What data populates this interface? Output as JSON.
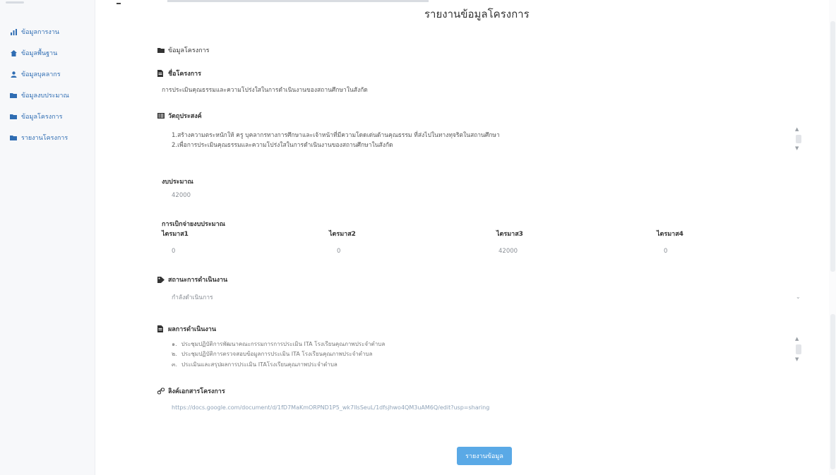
{
  "sidebar": {
    "items": [
      {
        "label": "ข้อมูลการงาน",
        "icon": "chart-icon"
      },
      {
        "label": "ข้อมูลพื้นฐาน",
        "icon": "home-icon"
      },
      {
        "label": "ข้อมูลบุคลากร",
        "icon": "user-icon"
      },
      {
        "label": "ข้อมูลงบประมาณ",
        "icon": "folder-icon"
      },
      {
        "label": "ข้อมูลโครงการ",
        "icon": "folder-icon"
      },
      {
        "label": "รายงานโครงการ",
        "icon": "folder-icon"
      }
    ]
  },
  "page": {
    "title": "รายงานข้อมูลโครงการ"
  },
  "section": {
    "header": "ข้อมูลโครงการ"
  },
  "project": {
    "name_label": "ชื่อโครงการ",
    "name_value": "การประเมินคุณธรรมและความโปร่งใสในการดำเนินงานของสถานศึกษาในสังกัด",
    "objective_label": "วัตถุประสงค์",
    "objective_lines": [
      "1.สร้างความตระหนักให้ ครู บุคลากรทางการศึกษาและเจ้าหน้าที่มีความโดดเด่นด้านคุณธรรม ที่ส่งไปในทางทุจริตในสถานศึกษา",
      "2.เพื่อการประเมินคุณธรรมและความโปร่งใสในการดำเนินงานของสถานศึกษาในสังกัด"
    ],
    "budget_label": "งบประมาณ",
    "budget_value": "42000",
    "disbursement_label": "การเบิกจ่ายงบประมาณ",
    "quarters": [
      {
        "label": "ไตรมาส1",
        "value": "0"
      },
      {
        "label": "ไตรมาส2",
        "value": "0"
      },
      {
        "label": "ไตรมาส3",
        "value": "42000"
      },
      {
        "label": "ไตรมาส4",
        "value": "0"
      }
    ],
    "status_label": "สถานะการดำเนินงาน",
    "status_value": "กำลังดำเนินการ",
    "result_label": "ผลการดำเนินงาน",
    "result_items": [
      "ประชุมปฏิบัติการพัฒนาคณะกรรมการการประเมิน ITA โรงเรียนคุณภาพประจำตำบล",
      "ประชุมปฏิบัติการตรวจสอบข้อมูลการประเมิน ITA โรงเรียนคุณภาพประจำตำบล",
      "ประเมินและสรุปผลการประเมิน ITAโรงเรียนคุณภาพประจำตำบล"
    ],
    "result_markers": [
      "๑.",
      "๒.",
      "๓."
    ],
    "doc_label": "ลิงค์เอกสารโครงการ",
    "doc_link": "https://docs.google.com/document/d/1fD7MaKmORPND1P5_wk7lIsSeuL/1dfsjhwo4QM3uAM6Q/edit?usp=sharing"
  },
  "actions": {
    "submit_label": "รายงานข้อมูล"
  }
}
